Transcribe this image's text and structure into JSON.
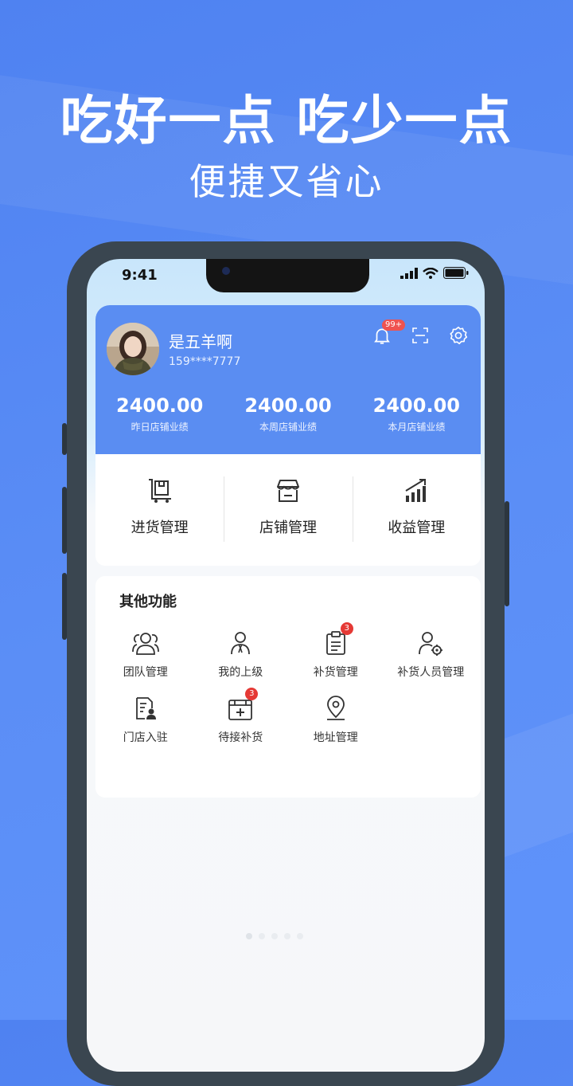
{
  "promo": {
    "headline": "吃好一点 吃少一点",
    "subline": "便捷又省心"
  },
  "status_bar": {
    "time": "9:41"
  },
  "profile": {
    "name": "是五羊啊",
    "phone": "159****7777",
    "notification_badge": "99+"
  },
  "stats": [
    {
      "value": "2400.00",
      "label": "昨日店铺业绩"
    },
    {
      "value": "2400.00",
      "label": "本周店铺业绩"
    },
    {
      "value": "2400.00",
      "label": "本月店铺业绩"
    }
  ],
  "management": [
    {
      "label": "进货管理",
      "icon": "cart-box-icon"
    },
    {
      "label": "店铺管理",
      "icon": "store-icon"
    },
    {
      "label": "收益管理",
      "icon": "growth-chart-icon"
    }
  ],
  "functions": {
    "title": "其他功能",
    "items": [
      {
        "label": "团队管理",
        "icon": "team-icon",
        "badge": ""
      },
      {
        "label": "我的上级",
        "icon": "superior-person-icon",
        "badge": ""
      },
      {
        "label": "补货管理",
        "icon": "clipboard-icon",
        "badge": "3"
      },
      {
        "label": "补货人员管理",
        "icon": "person-settings-icon",
        "badge": ""
      },
      {
        "label": "门店入驻",
        "icon": "document-person-icon",
        "badge": ""
      },
      {
        "label": "待接补货",
        "icon": "restock-box-icon",
        "badge": "3"
      },
      {
        "label": "地址管理",
        "icon": "location-pin-icon",
        "badge": ""
      }
    ]
  },
  "colors": {
    "background": "#5b8ef6",
    "card_blue": "#5a8df2",
    "badge_red": "#e53935"
  }
}
